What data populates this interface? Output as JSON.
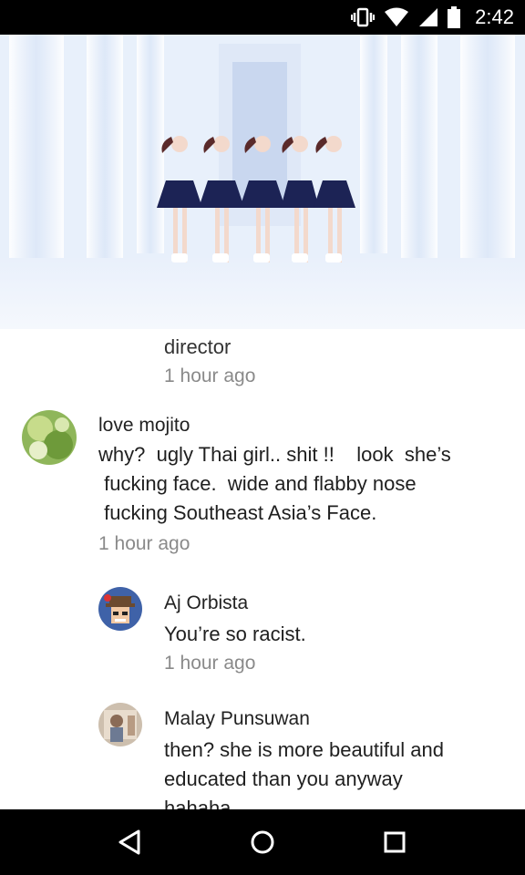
{
  "status_bar": {
    "time": "2:42",
    "icons": [
      "vibrate-icon",
      "wifi-icon",
      "cell-signal-icon",
      "battery-icon"
    ]
  },
  "video": {
    "description_icon": "video-thumbnail"
  },
  "comments": {
    "partial_reply": {
      "text": "director",
      "time": "1 hour ago"
    },
    "items": [
      {
        "author": "love mojito",
        "lines": [
          "why?  ugly Thai girl.. shit !!    look  she’s",
          " fucking face.  wide and flabby nose",
          " fucking Southeast Asia’s Face."
        ],
        "time": "1 hour ago",
        "replies": [
          {
            "author": "Aj Orbista",
            "text": "You’re so racist.",
            "time": "1 hour ago"
          },
          {
            "author": "Malay Punsuwan",
            "lines": [
              "then? she is more beautiful and",
              "educated than you anyway",
              "hahaha"
            ]
          }
        ]
      }
    ]
  },
  "nav_bar": {
    "back": "back-icon",
    "home": "home-icon",
    "recents": "recents-icon"
  }
}
